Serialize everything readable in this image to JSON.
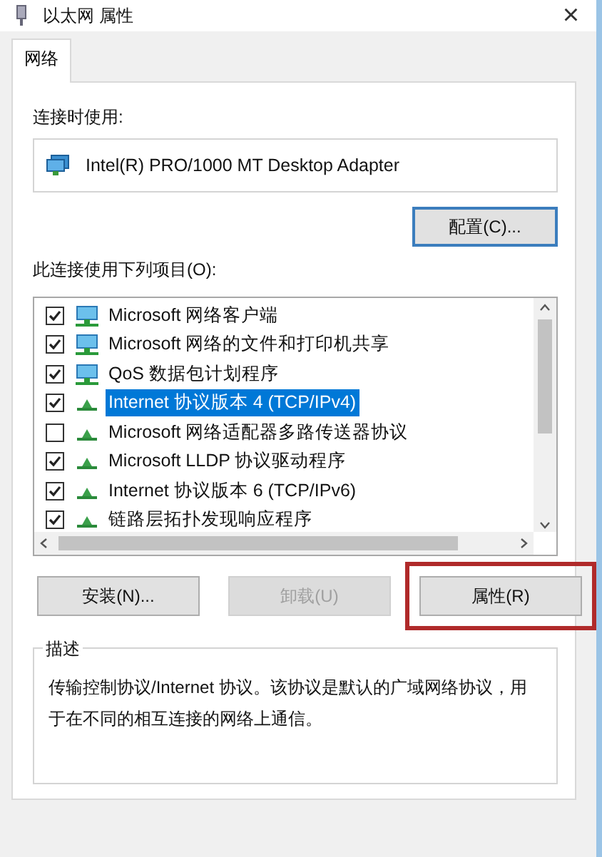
{
  "window": {
    "title": "以太网 属性",
    "close": "×"
  },
  "tabs": [
    {
      "label": "网络",
      "selected": true
    }
  ],
  "connect_using": {
    "label": "连接时使用:",
    "adapter": "Intel(R) PRO/1000 MT Desktop Adapter",
    "configure_button": "配置(C)..."
  },
  "items_label": "此连接使用下列项目(O):",
  "items": [
    {
      "label": "Microsoft 网络客户端",
      "kind": "client",
      "checked": true,
      "selected": false
    },
    {
      "label": "Microsoft 网络的文件和打印机共享",
      "kind": "client",
      "checked": true,
      "selected": false
    },
    {
      "label": "QoS 数据包计划程序",
      "kind": "client",
      "checked": true,
      "selected": false
    },
    {
      "label": "Internet 协议版本 4 (TCP/IPv4)",
      "kind": "protocol",
      "checked": true,
      "selected": true
    },
    {
      "label": "Microsoft 网络适配器多路传送器协议",
      "kind": "protocol",
      "checked": false,
      "selected": false
    },
    {
      "label": "Microsoft LLDP 协议驱动程序",
      "kind": "protocol",
      "checked": true,
      "selected": false
    },
    {
      "label": "Internet 协议版本 6 (TCP/IPv6)",
      "kind": "protocol",
      "checked": true,
      "selected": false
    },
    {
      "label": "链路层拓扑发现响应程序",
      "kind": "protocol",
      "checked": true,
      "selected": false
    }
  ],
  "buttons": [
    {
      "label": "安装(N)...",
      "disabled": false,
      "highlighted": false
    },
    {
      "label": "卸载(U)",
      "disabled": true,
      "highlighted": false
    },
    {
      "label": "属性(R)",
      "disabled": false,
      "highlighted": true
    }
  ],
  "description": {
    "label": "描述",
    "text": "传输控制协议/Internet 协议。该协议是默认的广域网络协议，用于在不同的相互连接的网络上通信。"
  }
}
